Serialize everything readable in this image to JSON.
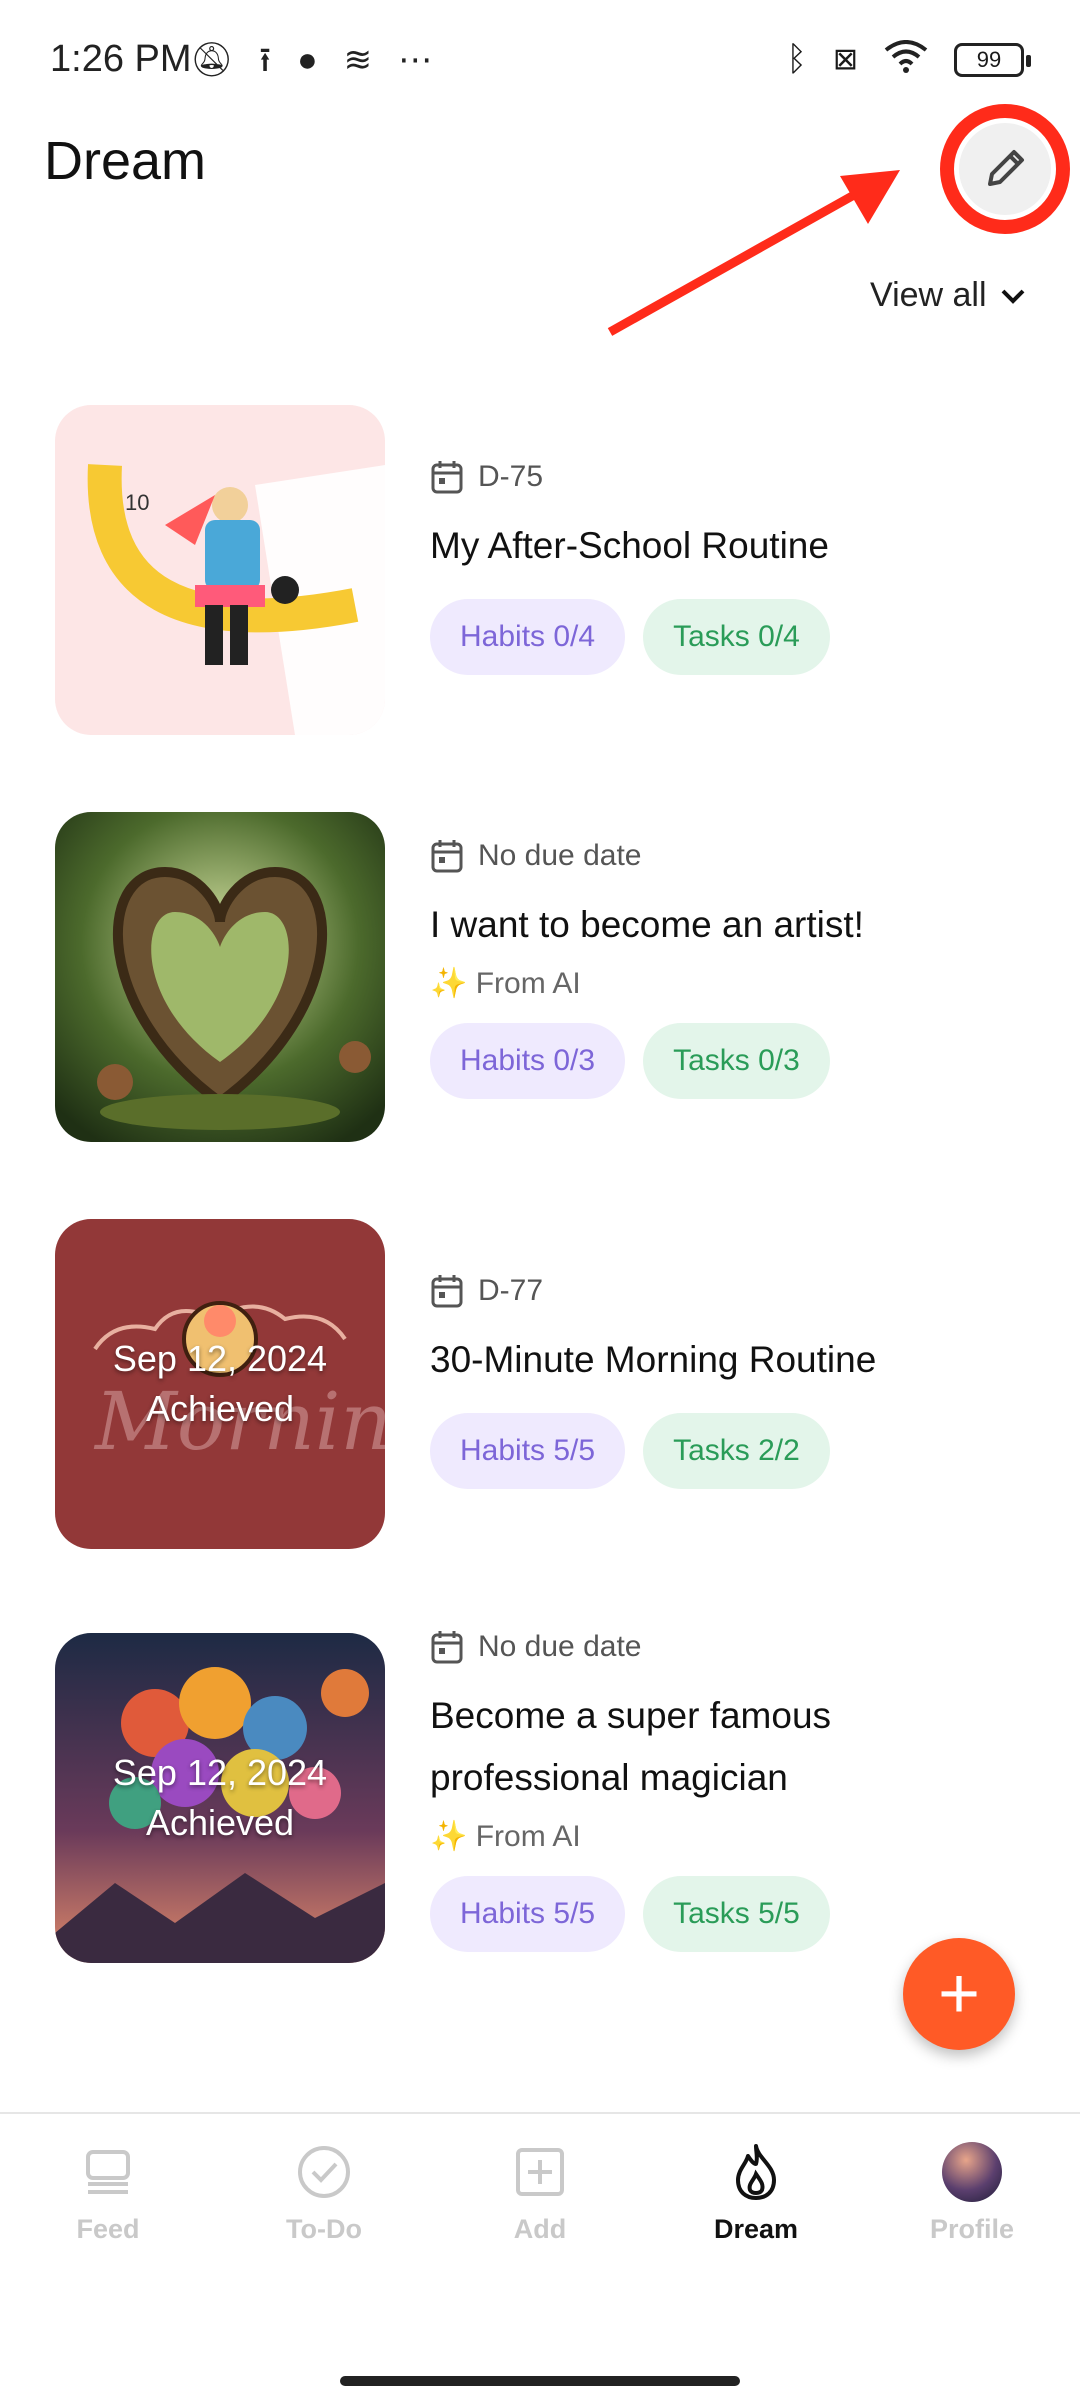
{
  "status_bar": {
    "time": "1:26 PM",
    "battery": "99",
    "icons": [
      "bell-off-icon",
      "upload-icon",
      "app-icon",
      "layers-icon",
      "more-icon",
      "bluetooth-icon",
      "sim-off-icon",
      "wifi-icon",
      "battery-icon"
    ]
  },
  "header": {
    "title": "Dream",
    "view_all": "View all"
  },
  "dreams": [
    {
      "due": "D-75",
      "title": "My After-School Routine",
      "from_ai": "",
      "habits": "Habits 0/4",
      "tasks": "Tasks 0/4",
      "achieved_date": "",
      "achieved_label": ""
    },
    {
      "due": "No due date",
      "title": "I want to become an artist!",
      "from_ai": "✨ From AI",
      "habits": "Habits 0/3",
      "tasks": "Tasks 0/3",
      "achieved_date": "",
      "achieved_label": ""
    },
    {
      "due": "D-77",
      "title": "30-Minute Morning Routine",
      "from_ai": "",
      "habits": "Habits 5/5",
      "tasks": "Tasks 2/2",
      "achieved_date": "Sep 12, 2024",
      "achieved_label": "Achieved"
    },
    {
      "due": "No due date",
      "title_line1": "Become a super famous",
      "title_line2": "professional magician",
      "from_ai": "✨ From AI",
      "habits": "Habits 5/5",
      "tasks": "Tasks 5/5",
      "achieved_date": "Sep 12, 2024",
      "achieved_label": "Achieved"
    }
  ],
  "fab": {
    "label": "+"
  },
  "nav": {
    "items": [
      {
        "label": "Feed",
        "icon": "feed-icon"
      },
      {
        "label": "To-Do",
        "icon": "todo-check-icon"
      },
      {
        "label": "Add",
        "icon": "add-square-icon"
      },
      {
        "label": "Dream",
        "icon": "flame-icon",
        "active": true
      },
      {
        "label": "Profile",
        "icon": "avatar"
      }
    ]
  },
  "colors": {
    "accent": "#ff5a26",
    "annotation": "#ff2b1a",
    "habits_bg": "#efeafe",
    "habits_fg": "#7d66d8",
    "tasks_bg": "#e3f5ea",
    "tasks_fg": "#2a9c58"
  }
}
